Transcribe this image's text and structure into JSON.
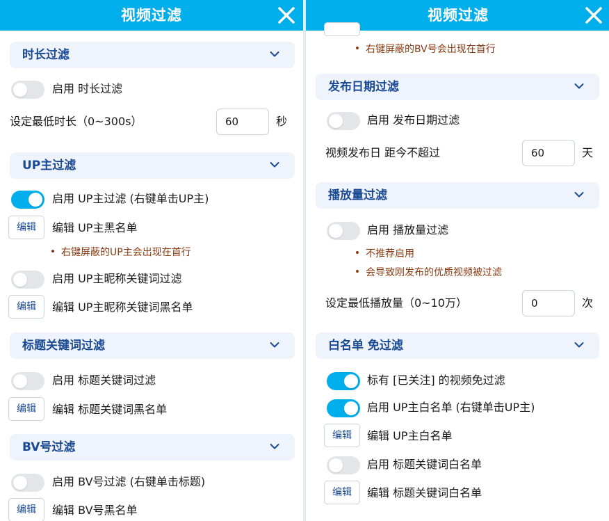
{
  "left": {
    "title": "视频过滤",
    "duration": {
      "title": "时长过滤",
      "toggle_label": "启用 时长过滤",
      "toggle_on": false,
      "setting_label": "设定最低时长（0~300s）",
      "value": "60",
      "unit": "秒"
    },
    "uploader": {
      "title": "UP主过滤",
      "toggle_label": "启用 UP主过滤 (右键单击UP主)",
      "toggle_on": true,
      "edit_button": "编辑",
      "edit_label": "编辑 UP主黑名单",
      "note": "右键屏蔽的UP主会出现在首行",
      "nick_toggle_label": "启用 UP主昵称关键词过滤",
      "nick_toggle_on": false,
      "nick_edit_button": "编辑",
      "nick_edit_label": "编辑 UP主昵称关键词黑名单"
    },
    "title_kw": {
      "title": "标题关键词过滤",
      "toggle_label": "启用 标题关键词过滤",
      "toggle_on": false,
      "edit_button": "编辑",
      "edit_label": "编辑 标题关键词黑名单"
    },
    "bv": {
      "title": "BV号过滤",
      "toggle_label": "启用 BV号过滤 (右键单击标题)",
      "toggle_on": false,
      "edit_button": "编辑",
      "edit_label": "编辑 BV号黑名单"
    }
  },
  "right": {
    "title": "视频过滤",
    "bv_note": "右键屏蔽的BV号会出现在首行",
    "date": {
      "title": "发布日期过滤",
      "toggle_label": "启用 发布日期过滤",
      "toggle_on": false,
      "setting_label": "视频发布日 距今不超过",
      "value": "60",
      "unit": "天"
    },
    "views": {
      "title": "播放量过滤",
      "toggle_label": "启用 播放量过滤",
      "toggle_on": false,
      "notes": [
        "不推荐启用",
        "会导致刚发布的优质视频被过滤"
      ],
      "setting_label": "设定最低播放量（0~10万）",
      "value": "0",
      "unit": "次"
    },
    "whitelist": {
      "title": "白名单 免过滤",
      "followed_label": "标有 [已关注] 的视频免过滤",
      "followed_on": true,
      "up_toggle_label": "启用 UP主白名单 (右键单击UP主)",
      "up_toggle_on": true,
      "up_edit_button": "编辑",
      "up_edit_label": "编辑 UP主白名单",
      "title_toggle_label": "启用 标题关键词白名单",
      "title_toggle_on": false,
      "title_edit_button": "编辑",
      "title_edit_label": "编辑 标题关键词白名单"
    }
  },
  "icons": {
    "close": "close-icon",
    "chevron": "chevron-down-icon"
  },
  "colors": {
    "header": "#00aeec",
    "section_bg": "#eef3fc",
    "section_title": "#1b4a94",
    "toggle_on": "#00aeec",
    "toggle_off": "#e3e5e8",
    "note": "#8c3a12"
  }
}
